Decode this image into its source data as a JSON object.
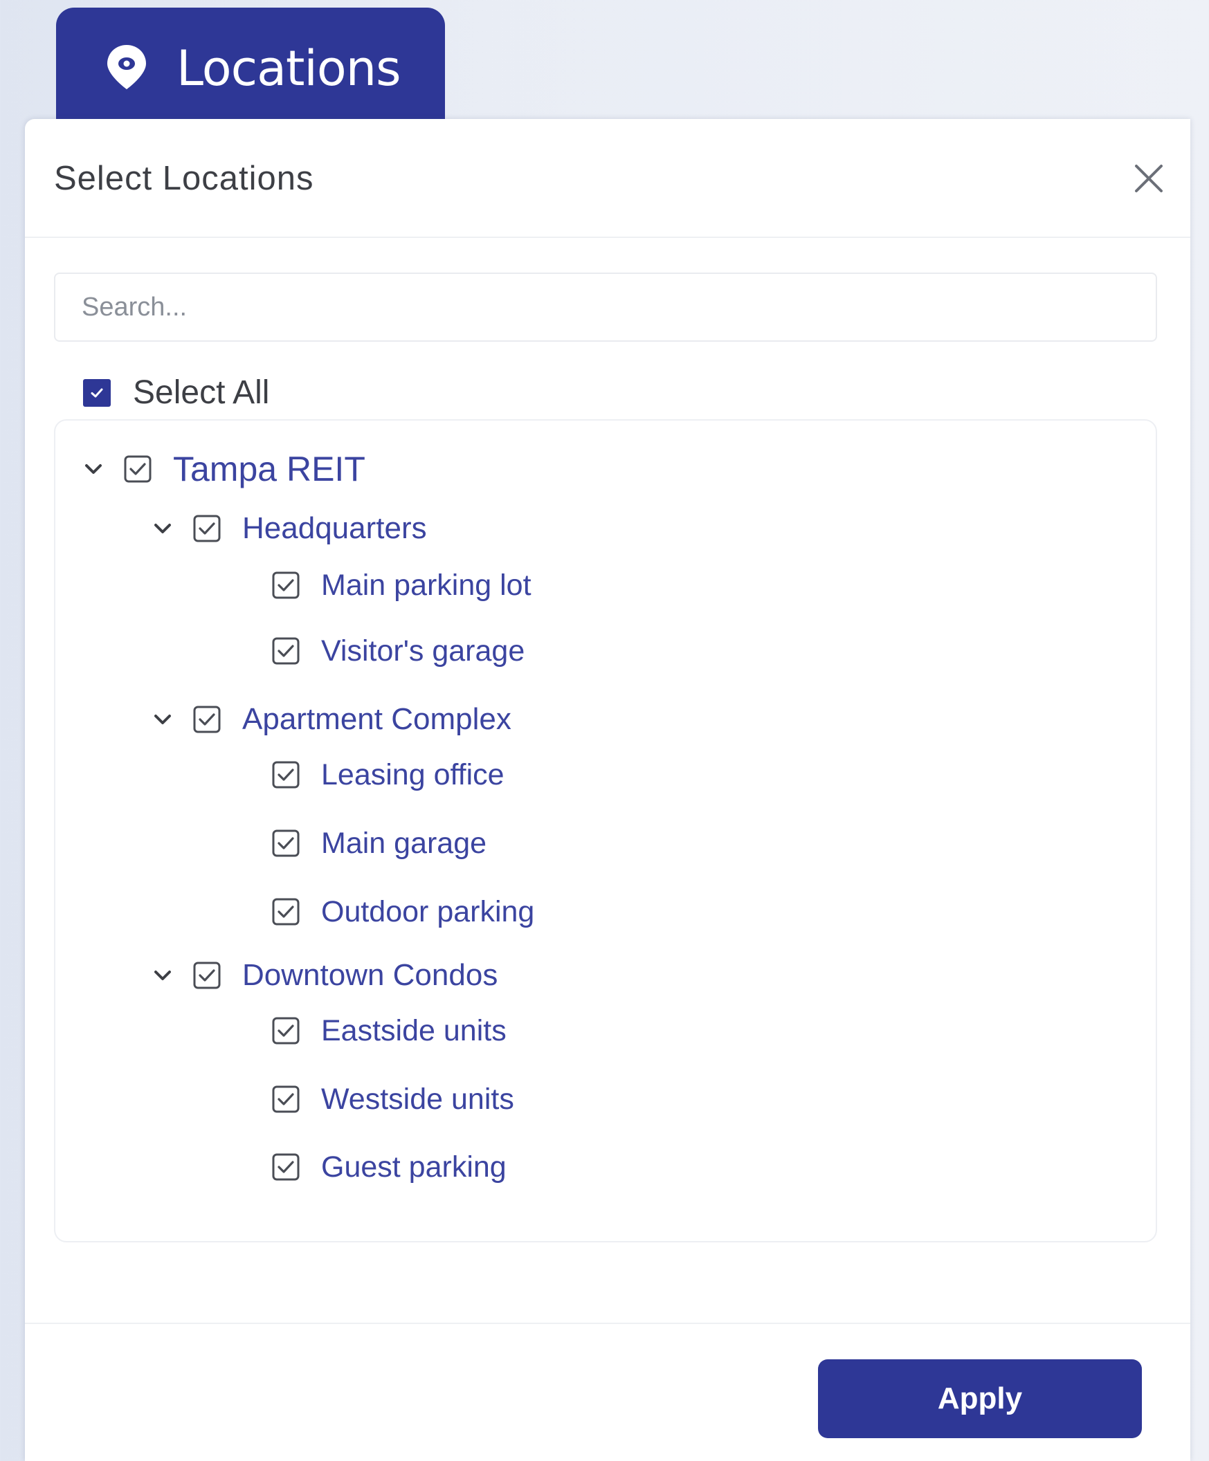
{
  "tab": {
    "label": "Locations",
    "icon": "map-pin-icon",
    "color": "#2e3796"
  },
  "dialog": {
    "title": "Select Locations",
    "close_icon": "close-icon"
  },
  "search": {
    "placeholder": "Search...",
    "value": ""
  },
  "select_all": {
    "label": "Select All",
    "checked": true
  },
  "tree": {
    "root": {
      "label": "Tampa REIT",
      "checked": true,
      "expanded": true,
      "groups": [
        {
          "label": "Headquarters",
          "checked": true,
          "expanded": true,
          "children": [
            {
              "label": "Main parking lot",
              "checked": true
            },
            {
              "label": "Visitor's garage",
              "checked": true
            }
          ]
        },
        {
          "label": "Apartment Complex",
          "checked": true,
          "expanded": true,
          "children": [
            {
              "label": "Leasing office",
              "checked": true
            },
            {
              "label": "Main garage",
              "checked": true
            },
            {
              "label": "Outdoor parking",
              "checked": true
            }
          ]
        },
        {
          "label": "Downtown Condos",
          "checked": true,
          "expanded": true,
          "children": [
            {
              "label": "Eastside units",
              "checked": true
            },
            {
              "label": "Westside units",
              "checked": true
            },
            {
              "label": "Guest parking",
              "checked": true
            }
          ]
        }
      ]
    }
  },
  "footer": {
    "apply_label": "Apply"
  },
  "colors": {
    "accent": "#2e3796",
    "tree_text": "#3b44a0",
    "title_text": "#3d3f45"
  }
}
